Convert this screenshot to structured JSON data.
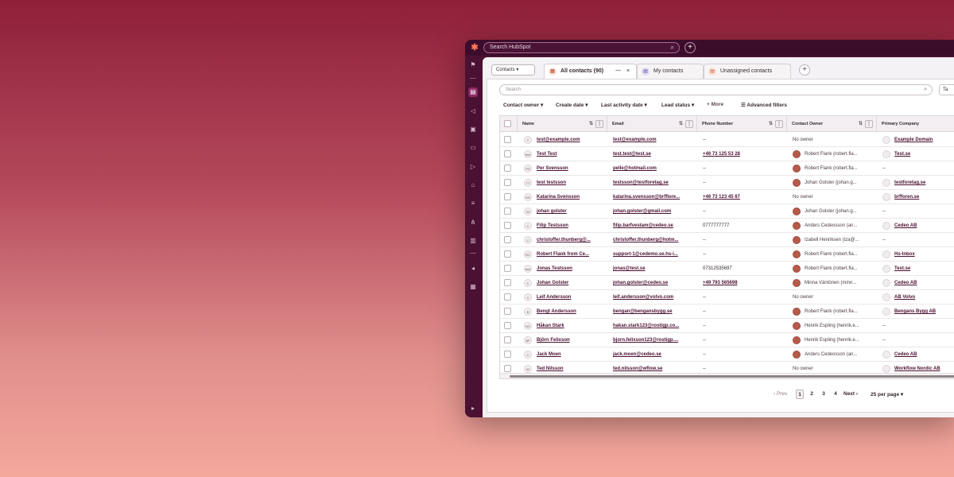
{
  "topbar": {
    "search_placeholder": "Search HubSpot",
    "plus": "+",
    "logo": "⚙"
  },
  "sidenav": {
    "icons": [
      "bookmark-icon",
      "contacts-icon",
      "megaphone-icon",
      "inbox-icon",
      "cart-icon",
      "video-icon",
      "bank-icon",
      "database-icon",
      "workflow-icon",
      "reports-icon",
      "arrow-icon",
      "settings-icon",
      "expand-icon"
    ]
  },
  "object_selector": {
    "label": "Contacts ▾"
  },
  "tabs": [
    {
      "label": "All contacts (90)",
      "extra": "⋯",
      "close": "×"
    },
    {
      "label": "My contacts"
    },
    {
      "label": "Unassigned contacts"
    }
  ],
  "tab_plus": "+",
  "toolbar": {
    "search_placeholder": "Search",
    "table_button": "Ta"
  },
  "filters": {
    "contact_owner": "Contact owner ▾",
    "create_date": "Create date ▾",
    "last_activity": "Last activity date ▾",
    "lead_status": "Lead status ▾",
    "more": "+ More",
    "advanced": "Advanced filters"
  },
  "columns": {
    "name": "Name",
    "email": "Email",
    "phone": "Phone Number",
    "owner": "Contact Owner",
    "company": "Primary Company"
  },
  "rows": [
    {
      "initials": "T",
      "name": "test@example.com",
      "email": "test@example.com",
      "phone": "--",
      "owner": "No owner",
      "company": "Example Domain"
    },
    {
      "initials": "test",
      "name": "Test Test",
      "email": "test.test@test.se",
      "phone": "+46 73 125 53 28",
      "owner": "Robert Flank (robert.fla...",
      "company": "Test.se"
    },
    {
      "initials": "PS",
      "name": "Per Svensson",
      "email": "pelle@hotmail.com",
      "phone": "--",
      "owner": "Robert Flank (robert.fla...",
      "company": "--"
    },
    {
      "initials": "TT",
      "name": "test testsson",
      "email": "testsson@testforetag.se",
      "phone": "--",
      "owner": "Johan Golster (johan.g...",
      "company": "testforetag.se"
    },
    {
      "initials": "KS",
      "name": "Katarina Svensson",
      "email": "katarina.svensson@brfflore...",
      "phone": "+46 73 123 45 67",
      "owner": "No owner",
      "company": "brfforen.se"
    },
    {
      "initials": "JG",
      "name": "johan golster",
      "email": "johan.golster@gmail.com",
      "phone": "--",
      "owner": "Johan Golster (johan.g...",
      "company": "--"
    },
    {
      "initials": "C",
      "name": "Filip Testsson",
      "email": "filip.barfvestam@cedeo.se",
      "phone": "0777777777",
      "owner": "Anders Cedeosson (an...",
      "company": "Cedeo AB"
    },
    {
      "initials": "C",
      "name": "christoffer.thunberg@...",
      "email": "christoffer.thunberg@hotm...",
      "phone": "--",
      "owner": "Izabell Henriksen (iza@...",
      "company": "--"
    },
    {
      "initials": "RC",
      "name": "Robert Flank from Ce...",
      "email": "support-1@cedemo.se.hs-i...",
      "phone": "--",
      "owner": "Robert Flank (robert.fla...",
      "company": "Hs-Inbox"
    },
    {
      "initials": "test",
      "name": "Jonas Testsson",
      "email": "jonas@test.se",
      "phone": "07312535697",
      "owner": "Robert Flank (robert.fla...",
      "company": "Test.se"
    },
    {
      "initials": "C",
      "name": "Johan Golster",
      "email": "johan.golster@cedeo.se",
      "phone": "+49 793 565698",
      "owner": "Minna Väntönen (minn...",
      "company": "Cedeo AB"
    },
    {
      "initials": "V",
      "name": "Leif Andersson",
      "email": "leif.andersson@volvo.com",
      "phone": "--",
      "owner": "No owner",
      "company": "AB Volvo"
    },
    {
      "initials": "B",
      "name": "Bengt Andersson",
      "email": "bengan@bengansbygg.se",
      "phone": "--",
      "owner": "Robert Flank (robert.fla...",
      "company": "Bengans Bygg AB"
    },
    {
      "initials": "HS",
      "name": "Håkan Stark",
      "email": "hakan.stark123@rostigp.co...",
      "phone": "--",
      "owner": "Henrik Espling (henrik.e...",
      "company": "--"
    },
    {
      "initials": "BF",
      "name": "Björn Felixson",
      "email": "bjorn.felixson123@rostigp....",
      "phone": "--",
      "owner": "Henrik Espling (henrik.e...",
      "company": "--"
    },
    {
      "initials": "C",
      "name": "Jack Moen",
      "email": "jack.moen@cedeo.se",
      "phone": "--",
      "owner": "Anders Cedeosson (an...",
      "company": "Cedeo AB"
    },
    {
      "initials": "W",
      "name": "Ted Nilsson",
      "email": "ted.nilsson@wflow.se",
      "phone": "--",
      "owner": "No owner",
      "company": "Workflow Nordic AB"
    }
  ],
  "pagination": {
    "prev": "‹ Prev",
    "pages": [
      "1",
      "2",
      "3",
      "4"
    ],
    "next": "Next ›",
    "per_page": "25 per page ▾"
  },
  "colors": {
    "accent": "#4a1132",
    "brand_orange": "#ff7a59",
    "link": "#4a1030"
  }
}
